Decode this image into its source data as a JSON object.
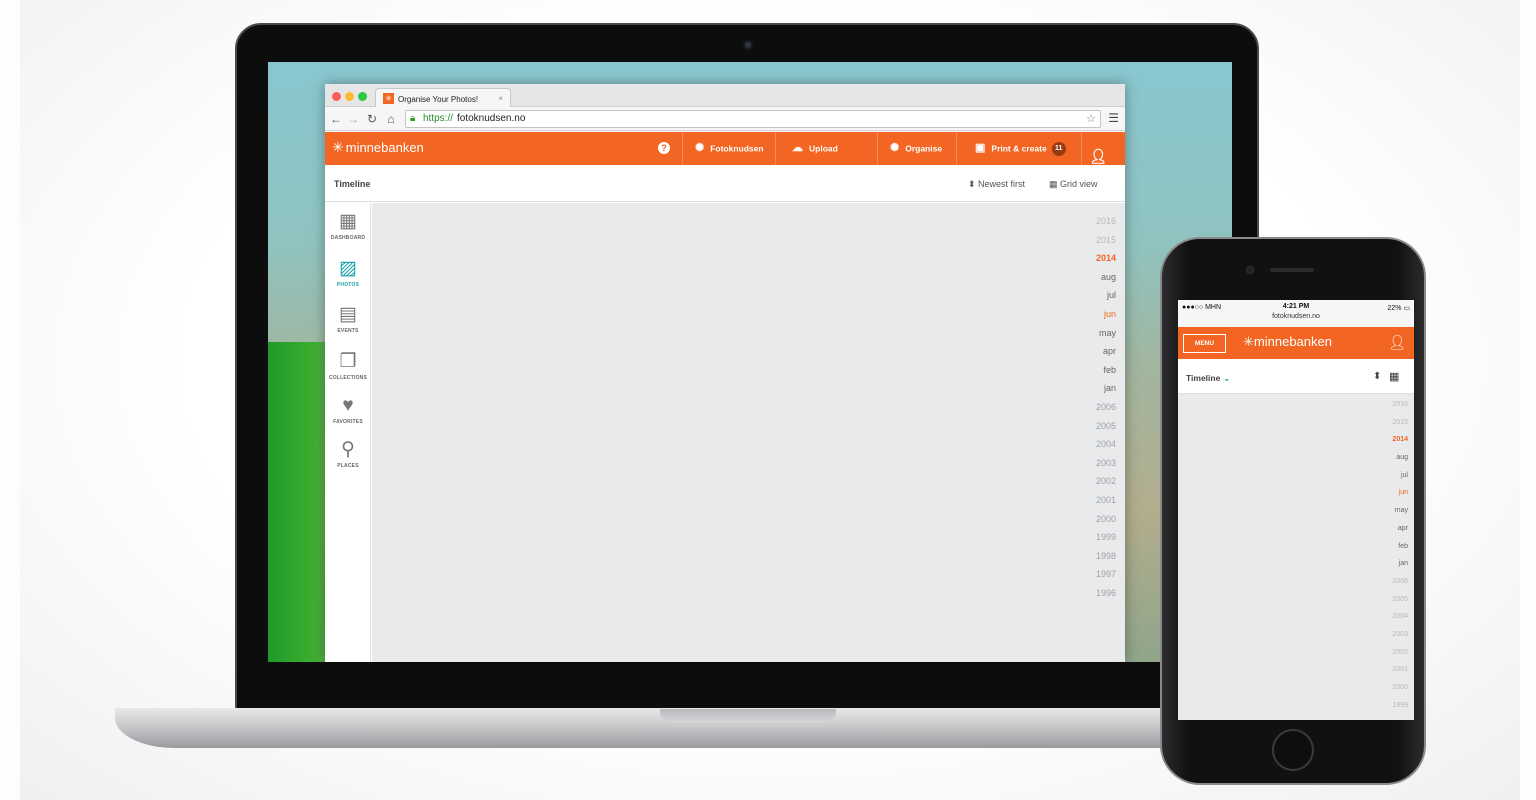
{
  "browser": {
    "tab_title": "Organise Your Photos!",
    "tab_close": "×",
    "url_scheme": "https://",
    "url_host": "fotoknudsen.no"
  },
  "app": {
    "logo_text": "minnebanken",
    "help_label": "?",
    "nav": [
      {
        "label": "Fotoknudsen",
        "icon": "aperture-icon"
      },
      {
        "label": "Upload",
        "icon": "cloud-upload-icon"
      },
      {
        "label": "Organise",
        "icon": "aperture-icon"
      },
      {
        "label": "Print & create",
        "icon": "photo-print-icon",
        "badge": "11"
      }
    ],
    "subheader": {
      "title": "Timeline",
      "sort_label": "Newest first",
      "view_label": "Grid view"
    },
    "sidebar": [
      {
        "label": "DASHBOARD",
        "icon": "grid-icon",
        "active": false
      },
      {
        "label": "PHOTOS",
        "icon": "photos-icon",
        "active": true
      },
      {
        "label": "EVENTS",
        "icon": "calendar-icon",
        "active": false
      },
      {
        "label": "COLLECTIONS",
        "icon": "album-icon",
        "active": false
      },
      {
        "label": "FAVORITES",
        "icon": "heart-icon",
        "active": false
      },
      {
        "label": "PLACES",
        "icon": "map-pin-icon",
        "active": false
      }
    ],
    "timeline": {
      "years_before": [
        "2016",
        "2015"
      ],
      "current_year": "2014",
      "months": [
        "aug",
        "jul",
        "jun",
        "may",
        "apr",
        "feb",
        "jan"
      ],
      "current_month": "jun",
      "years_after": [
        "2006",
        "2005",
        "2004",
        "2003",
        "2002",
        "2001",
        "2000",
        "1999",
        "1998",
        "1997",
        "1996"
      ]
    }
  },
  "phone": {
    "status": {
      "carrier": "●●●○○ MHN",
      "time": "4:21 PM",
      "url": "fotoknudsen.no",
      "battery": "22%"
    },
    "menu_label": "MENU",
    "logo_text": "minnebanken",
    "title": "Timeline",
    "timeline": {
      "years_before": [
        "2016",
        "2015"
      ],
      "current_year": "2014",
      "months": [
        "aug",
        "jul",
        "jun",
        "may",
        "apr",
        "feb",
        "jan"
      ],
      "current_month": "jun",
      "years_after": [
        "2006",
        "2005",
        "2004",
        "2003",
        "2002",
        "2001",
        "2000",
        "1999"
      ]
    }
  },
  "colors": {
    "brand_orange": "#f26522",
    "active_teal": "#1aa3a8",
    "content_bg": "#e9eaeb"
  }
}
